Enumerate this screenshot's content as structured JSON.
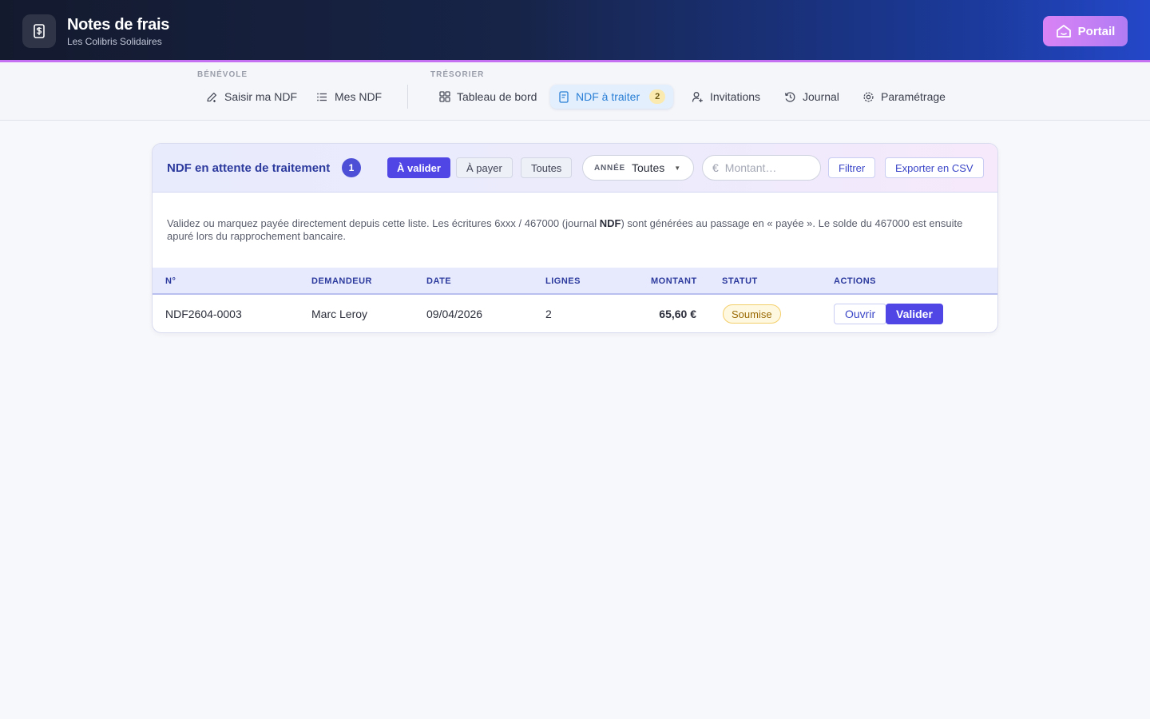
{
  "app": {
    "title": "Notes de frais",
    "subtitle": "Les Colibris Solidaires",
    "portal_label": "Portail"
  },
  "nav": {
    "sections": [
      {
        "label": "BÉNÉVOLE"
      },
      {
        "label": "TRÉSORIER"
      }
    ],
    "items": [
      {
        "label": "Saisir ma NDF",
        "icon": "edit-icon"
      },
      {
        "label": "Mes NDF",
        "icon": "list-icon"
      },
      {
        "label": "Tableau de bord",
        "icon": "dashboard-icon"
      },
      {
        "label": "NDF à traiter",
        "icon": "receipt-icon",
        "badge": "2",
        "active": true
      },
      {
        "label": "Invitations",
        "icon": "user-plus-icon"
      },
      {
        "label": "Journal",
        "icon": "history-icon"
      },
      {
        "label": "Paramétrage",
        "icon": "gear-icon"
      }
    ]
  },
  "card": {
    "title": "NDF en attente de traitement",
    "count": "1",
    "filters": {
      "to_validate": "À valider",
      "to_pay": "À payer",
      "all": "Toutes"
    },
    "year": {
      "label": "ANNÉE",
      "value": "Toutes"
    },
    "amount": {
      "symbol": "€",
      "placeholder": "Montant…",
      "value": ""
    },
    "filter_button": "Filtrer",
    "export_button": "Exporter en CSV",
    "description_part1": "Validez ou marquez payée directement depuis cette liste. Les écritures 6xxx / 467000 (journal ",
    "description_bold": "NDF",
    "description_part2": ") sont générées au passage en « payée ». Le solde du 467000 est ensuite apuré lors du rapprochement bancaire."
  },
  "table": {
    "headers": {
      "number": "N°",
      "requester": "DEMANDEUR",
      "date": "DATE",
      "lines": "LIGNES",
      "amount": "MONTANT",
      "status": "STATUT",
      "actions": "ACTIONS"
    },
    "rows": [
      {
        "number": "NDF2604-0003",
        "requester": "Marc Leroy",
        "date": "09/04/2026",
        "lines": "2",
        "amount": "65,60 €",
        "status": "Soumise",
        "open_label": "Ouvrir",
        "validate_label": "Valider"
      }
    ]
  },
  "colors": {
    "accent": "#4f46e5",
    "active_nav": "#2a7fd6",
    "status_pending": "#f3cf6a",
    "header_border": "#c56ff2"
  }
}
